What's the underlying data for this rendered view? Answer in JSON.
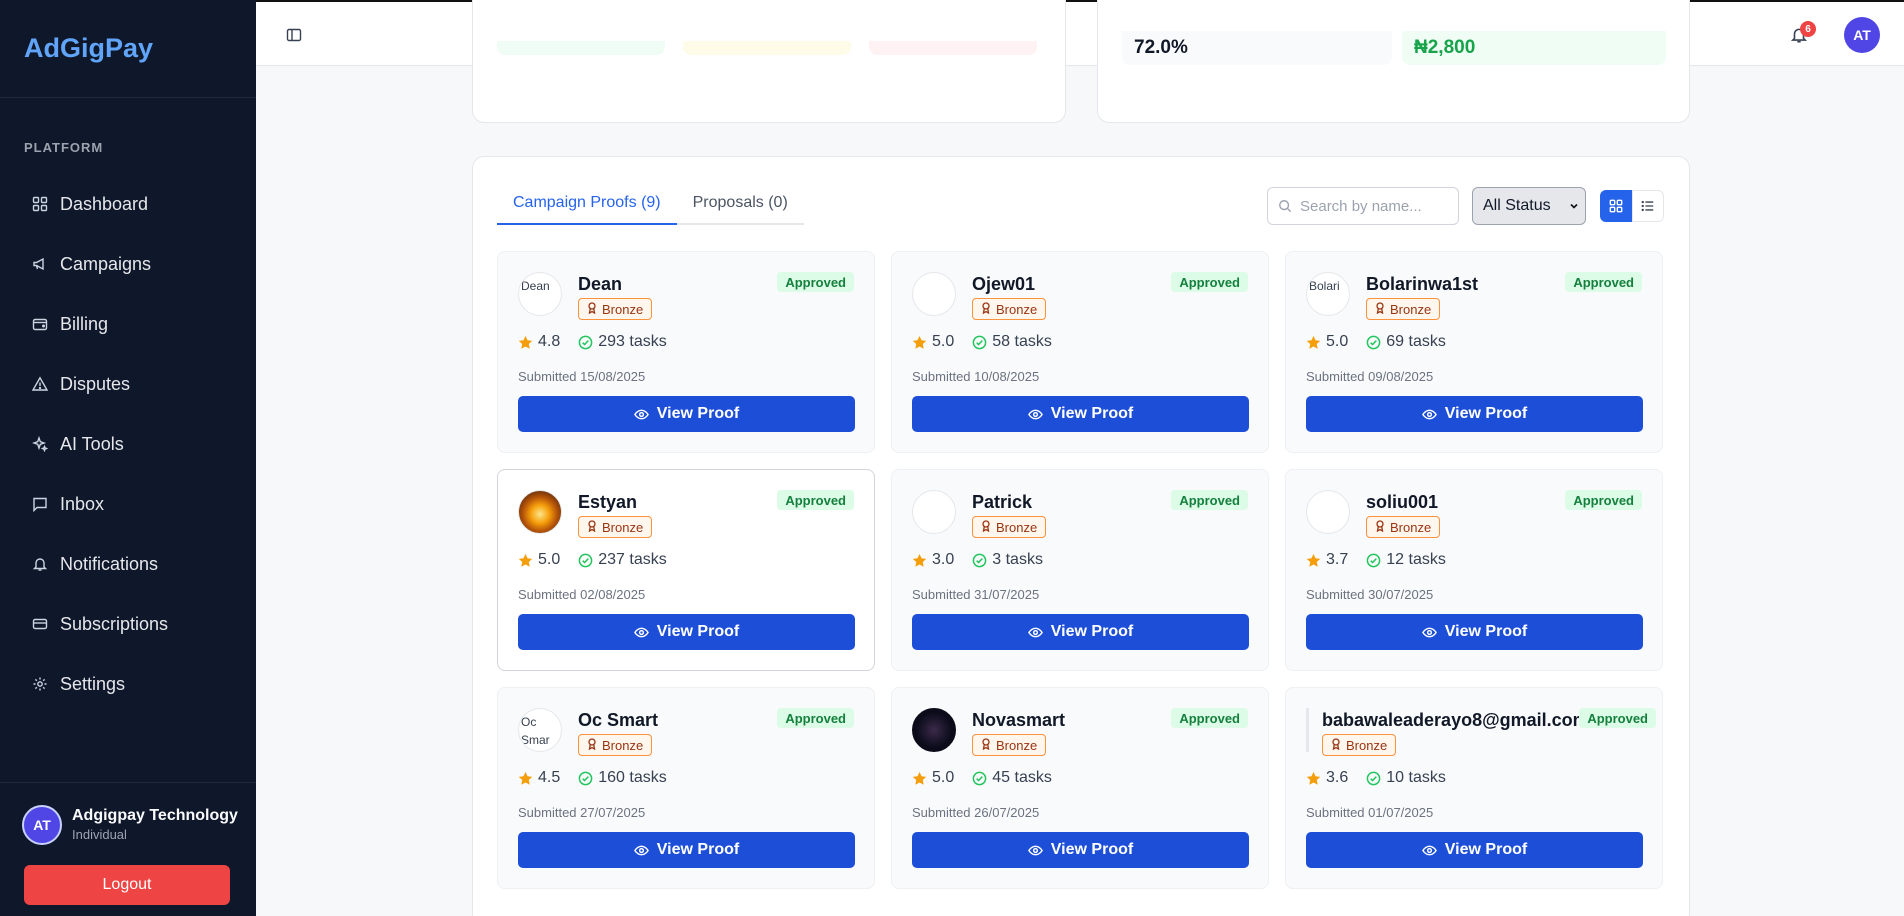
{
  "app": {
    "brand": "AdGigPay"
  },
  "sidebar": {
    "section_label": "PLATFORM",
    "items": [
      {
        "label": "Dashboard",
        "icon": "dashboard-icon"
      },
      {
        "label": "Campaigns",
        "icon": "megaphone-icon"
      },
      {
        "label": "Billing",
        "icon": "wallet-icon"
      },
      {
        "label": "Disputes",
        "icon": "warning-icon"
      },
      {
        "label": "AI Tools",
        "icon": "sparkles-icon"
      },
      {
        "label": "Inbox",
        "icon": "message-icon"
      },
      {
        "label": "Notifications",
        "icon": "bell-icon"
      },
      {
        "label": "Subscriptions",
        "icon": "credit-card-icon"
      },
      {
        "label": "Settings",
        "icon": "gear-icon"
      }
    ],
    "user": {
      "initials": "AT",
      "name": "Adgigpay Technology",
      "role": "Individual"
    },
    "logout_label": "Logout"
  },
  "topbar": {
    "notification_count": "6",
    "avatar_initials": "AT"
  },
  "stats": {
    "rate": "72.0%",
    "amount": "₦2,800"
  },
  "proofs_panel": {
    "tabs": [
      {
        "label": "Campaign Proofs (9)",
        "active": true
      },
      {
        "label": "Proposals (0)",
        "active": false
      }
    ],
    "search_placeholder": "Search by name...",
    "status_filter": "All Status",
    "view_proof_label": "View Proof",
    "items": [
      {
        "name": "Dean",
        "tier": "Bronze",
        "status": "Approved",
        "rating": "4.8",
        "tasks": "293 tasks",
        "submitted": "Submitted 15/08/2025",
        "avatar_alt": "Dean"
      },
      {
        "name": "Ojew01",
        "tier": "Bronze",
        "status": "Approved",
        "rating": "5.0",
        "tasks": "58 tasks",
        "submitted": "Submitted 10/08/2025",
        "avatar_alt": ""
      },
      {
        "name": "Bolarinwa1st",
        "tier": "Bronze",
        "status": "Approved",
        "rating": "5.0",
        "tasks": "69 tasks",
        "submitted": "Submitted 09/08/2025",
        "avatar_alt": "Bolari"
      },
      {
        "name": "Estyan",
        "tier": "Bronze",
        "status": "Approved",
        "rating": "5.0",
        "tasks": "237 tasks",
        "submitted": "Submitted 02/08/2025",
        "avatar_alt": ""
      },
      {
        "name": "Patrick",
        "tier": "Bronze",
        "status": "Approved",
        "rating": "3.0",
        "tasks": "3 tasks",
        "submitted": "Submitted 31/07/2025",
        "avatar_alt": ""
      },
      {
        "name": "soliu001",
        "tier": "Bronze",
        "status": "Approved",
        "rating": "3.7",
        "tasks": "12 tasks",
        "submitted": "Submitted 30/07/2025",
        "avatar_alt": ""
      },
      {
        "name": "Oc Smart",
        "tier": "Bronze",
        "status": "Approved",
        "rating": "4.5",
        "tasks": "160 tasks",
        "submitted": "Submitted 27/07/2025",
        "avatar_alt": "Oc Smar"
      },
      {
        "name": "Novasmart",
        "tier": "Bronze",
        "status": "Approved",
        "rating": "5.0",
        "tasks": "45 tasks",
        "submitted": "Submitted 26/07/2025",
        "avatar_alt": ""
      },
      {
        "name": "babawaleaderayo8@gmail.com",
        "tier": "Bronze",
        "status": "Approved",
        "rating": "3.6",
        "tasks": "10 tasks",
        "submitted": "Submitted 01/07/2025",
        "avatar_alt": ""
      }
    ]
  },
  "colors": {
    "primary": "#1d4ed8",
    "sidebar_bg": "#0f172a",
    "approved": "#15803d",
    "danger": "#ef4444"
  }
}
